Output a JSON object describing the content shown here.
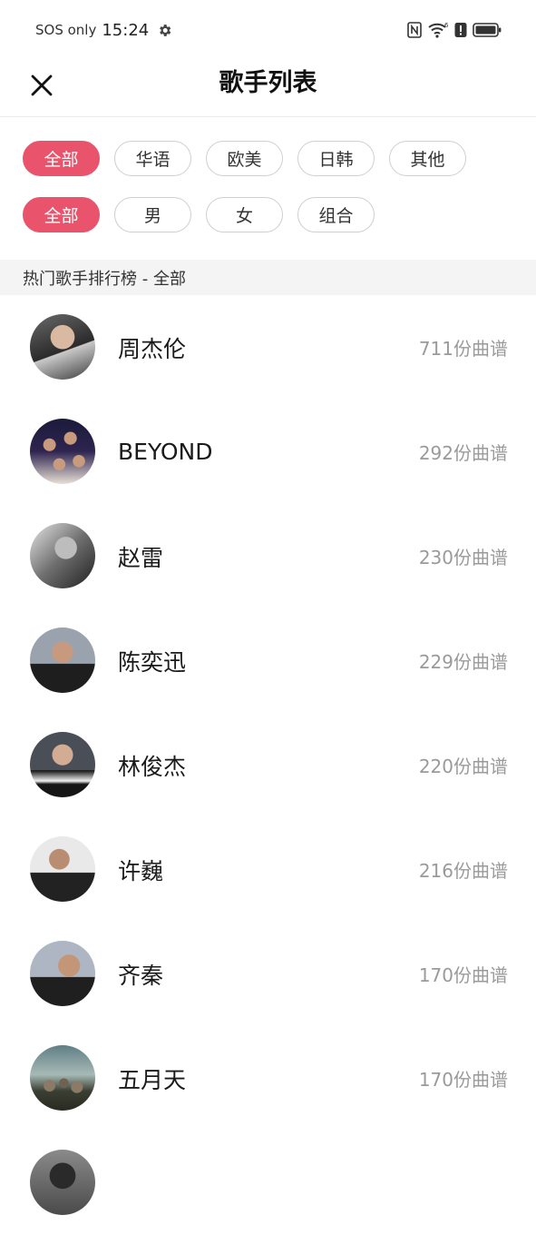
{
  "status_bar": {
    "carrier": "SOS only",
    "time": "15:24",
    "icons": [
      "gear-icon",
      "nfc-icon",
      "wifi-icon",
      "alert-icon",
      "battery-icon"
    ]
  },
  "header": {
    "title": "歌手列表",
    "close_icon": "close-icon"
  },
  "filters": {
    "region": [
      {
        "label": "全部",
        "active": true
      },
      {
        "label": "华语",
        "active": false
      },
      {
        "label": "欧美",
        "active": false
      },
      {
        "label": "日韩",
        "active": false
      },
      {
        "label": "其他",
        "active": false
      }
    ],
    "gender": [
      {
        "label": "全部",
        "active": true
      },
      {
        "label": "男",
        "active": false
      },
      {
        "label": "女",
        "active": false
      },
      {
        "label": "组合",
        "active": false
      }
    ]
  },
  "section": {
    "title": "热门歌手排行榜 - 全部"
  },
  "singers": [
    {
      "name": "周杰伦",
      "count": "711份曲谱"
    },
    {
      "name": "BEYOND",
      "count": "292份曲谱"
    },
    {
      "name": "赵雷",
      "count": "230份曲谱"
    },
    {
      "name": "陈奕迅",
      "count": "229份曲谱"
    },
    {
      "name": "林俊杰",
      "count": "220份曲谱"
    },
    {
      "name": "许巍",
      "count": "216份曲谱"
    },
    {
      "name": "齐秦",
      "count": "170份曲谱"
    },
    {
      "name": "五月天",
      "count": "170份曲谱"
    }
  ],
  "colors": {
    "accent": "#e9536b",
    "count_text": "#9a9a9a",
    "section_bg": "#f4f4f5"
  }
}
